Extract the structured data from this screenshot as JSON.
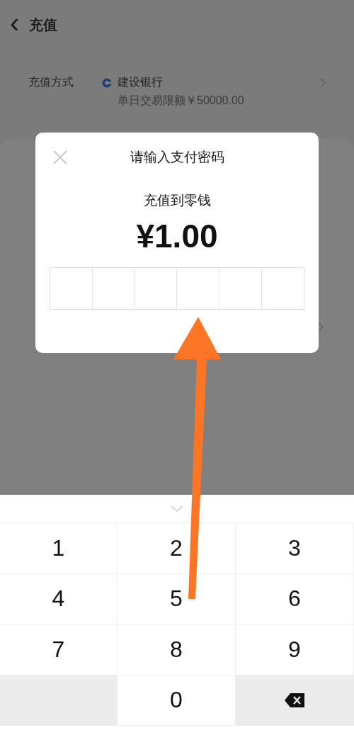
{
  "header": {
    "back": "‹",
    "title": "充值"
  },
  "payment_method": {
    "label": "充值方式",
    "bank": "建设银行",
    "limit": "单日交易限额￥50000.00"
  },
  "dialog": {
    "title": "请输入支付密码",
    "subtitle": "充值到零钱",
    "amount": "¥1.00",
    "password_cells": [
      {
        "filled": false
      },
      {
        "filled": false
      },
      {
        "filled": false
      },
      {
        "filled": false
      },
      {
        "filled": false
      },
      {
        "filled": false
      }
    ]
  },
  "keypad": {
    "keys": [
      {
        "kind": "digit",
        "label": "1"
      },
      {
        "kind": "digit",
        "label": "2"
      },
      {
        "kind": "digit",
        "label": "3"
      },
      {
        "kind": "digit",
        "label": "4"
      },
      {
        "kind": "digit",
        "label": "5"
      },
      {
        "kind": "digit",
        "label": "6"
      },
      {
        "kind": "digit",
        "label": "7"
      },
      {
        "kind": "digit",
        "label": "8"
      },
      {
        "kind": "digit",
        "label": "9"
      },
      {
        "kind": "blank"
      },
      {
        "kind": "digit",
        "label": "0"
      },
      {
        "kind": "delete"
      }
    ]
  }
}
